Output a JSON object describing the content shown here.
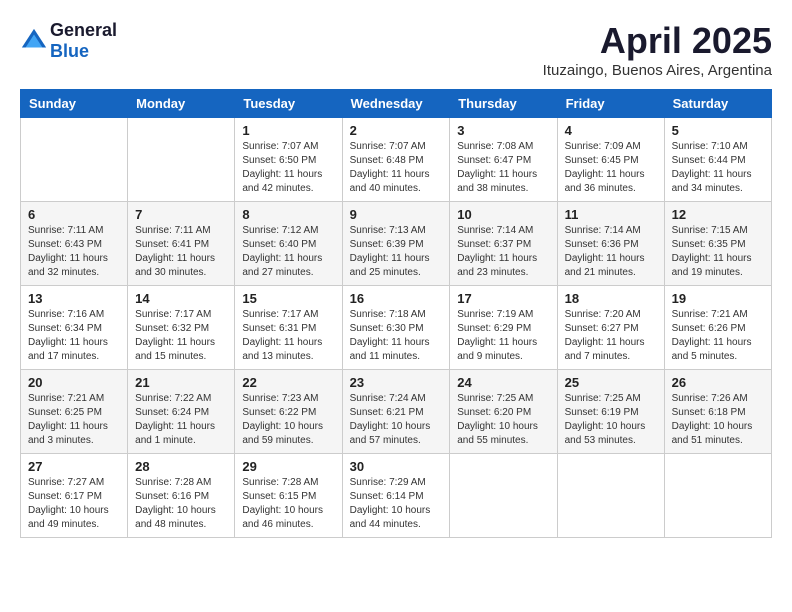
{
  "header": {
    "logo": {
      "general": "General",
      "blue": "Blue"
    },
    "title": "April 2025",
    "subtitle": "Ituzaingo, Buenos Aires, Argentina"
  },
  "calendar": {
    "days_of_week": [
      "Sunday",
      "Monday",
      "Tuesday",
      "Wednesday",
      "Thursday",
      "Friday",
      "Saturday"
    ],
    "weeks": [
      [
        {
          "day": "",
          "info": ""
        },
        {
          "day": "",
          "info": ""
        },
        {
          "day": "1",
          "info": "Sunrise: 7:07 AM\nSunset: 6:50 PM\nDaylight: 11 hours and 42 minutes."
        },
        {
          "day": "2",
          "info": "Sunrise: 7:07 AM\nSunset: 6:48 PM\nDaylight: 11 hours and 40 minutes."
        },
        {
          "day": "3",
          "info": "Sunrise: 7:08 AM\nSunset: 6:47 PM\nDaylight: 11 hours and 38 minutes."
        },
        {
          "day": "4",
          "info": "Sunrise: 7:09 AM\nSunset: 6:45 PM\nDaylight: 11 hours and 36 minutes."
        },
        {
          "day": "5",
          "info": "Sunrise: 7:10 AM\nSunset: 6:44 PM\nDaylight: 11 hours and 34 minutes."
        }
      ],
      [
        {
          "day": "6",
          "info": "Sunrise: 7:11 AM\nSunset: 6:43 PM\nDaylight: 11 hours and 32 minutes."
        },
        {
          "day": "7",
          "info": "Sunrise: 7:11 AM\nSunset: 6:41 PM\nDaylight: 11 hours and 30 minutes."
        },
        {
          "day": "8",
          "info": "Sunrise: 7:12 AM\nSunset: 6:40 PM\nDaylight: 11 hours and 27 minutes."
        },
        {
          "day": "9",
          "info": "Sunrise: 7:13 AM\nSunset: 6:39 PM\nDaylight: 11 hours and 25 minutes."
        },
        {
          "day": "10",
          "info": "Sunrise: 7:14 AM\nSunset: 6:37 PM\nDaylight: 11 hours and 23 minutes."
        },
        {
          "day": "11",
          "info": "Sunrise: 7:14 AM\nSunset: 6:36 PM\nDaylight: 11 hours and 21 minutes."
        },
        {
          "day": "12",
          "info": "Sunrise: 7:15 AM\nSunset: 6:35 PM\nDaylight: 11 hours and 19 minutes."
        }
      ],
      [
        {
          "day": "13",
          "info": "Sunrise: 7:16 AM\nSunset: 6:34 PM\nDaylight: 11 hours and 17 minutes."
        },
        {
          "day": "14",
          "info": "Sunrise: 7:17 AM\nSunset: 6:32 PM\nDaylight: 11 hours and 15 minutes."
        },
        {
          "day": "15",
          "info": "Sunrise: 7:17 AM\nSunset: 6:31 PM\nDaylight: 11 hours and 13 minutes."
        },
        {
          "day": "16",
          "info": "Sunrise: 7:18 AM\nSunset: 6:30 PM\nDaylight: 11 hours and 11 minutes."
        },
        {
          "day": "17",
          "info": "Sunrise: 7:19 AM\nSunset: 6:29 PM\nDaylight: 11 hours and 9 minutes."
        },
        {
          "day": "18",
          "info": "Sunrise: 7:20 AM\nSunset: 6:27 PM\nDaylight: 11 hours and 7 minutes."
        },
        {
          "day": "19",
          "info": "Sunrise: 7:21 AM\nSunset: 6:26 PM\nDaylight: 11 hours and 5 minutes."
        }
      ],
      [
        {
          "day": "20",
          "info": "Sunrise: 7:21 AM\nSunset: 6:25 PM\nDaylight: 11 hours and 3 minutes."
        },
        {
          "day": "21",
          "info": "Sunrise: 7:22 AM\nSunset: 6:24 PM\nDaylight: 11 hours and 1 minute."
        },
        {
          "day": "22",
          "info": "Sunrise: 7:23 AM\nSunset: 6:22 PM\nDaylight: 10 hours and 59 minutes."
        },
        {
          "day": "23",
          "info": "Sunrise: 7:24 AM\nSunset: 6:21 PM\nDaylight: 10 hours and 57 minutes."
        },
        {
          "day": "24",
          "info": "Sunrise: 7:25 AM\nSunset: 6:20 PM\nDaylight: 10 hours and 55 minutes."
        },
        {
          "day": "25",
          "info": "Sunrise: 7:25 AM\nSunset: 6:19 PM\nDaylight: 10 hours and 53 minutes."
        },
        {
          "day": "26",
          "info": "Sunrise: 7:26 AM\nSunset: 6:18 PM\nDaylight: 10 hours and 51 minutes."
        }
      ],
      [
        {
          "day": "27",
          "info": "Sunrise: 7:27 AM\nSunset: 6:17 PM\nDaylight: 10 hours and 49 minutes."
        },
        {
          "day": "28",
          "info": "Sunrise: 7:28 AM\nSunset: 6:16 PM\nDaylight: 10 hours and 48 minutes."
        },
        {
          "day": "29",
          "info": "Sunrise: 7:28 AM\nSunset: 6:15 PM\nDaylight: 10 hours and 46 minutes."
        },
        {
          "day": "30",
          "info": "Sunrise: 7:29 AM\nSunset: 6:14 PM\nDaylight: 10 hours and 44 minutes."
        },
        {
          "day": "",
          "info": ""
        },
        {
          "day": "",
          "info": ""
        },
        {
          "day": "",
          "info": ""
        }
      ]
    ]
  }
}
